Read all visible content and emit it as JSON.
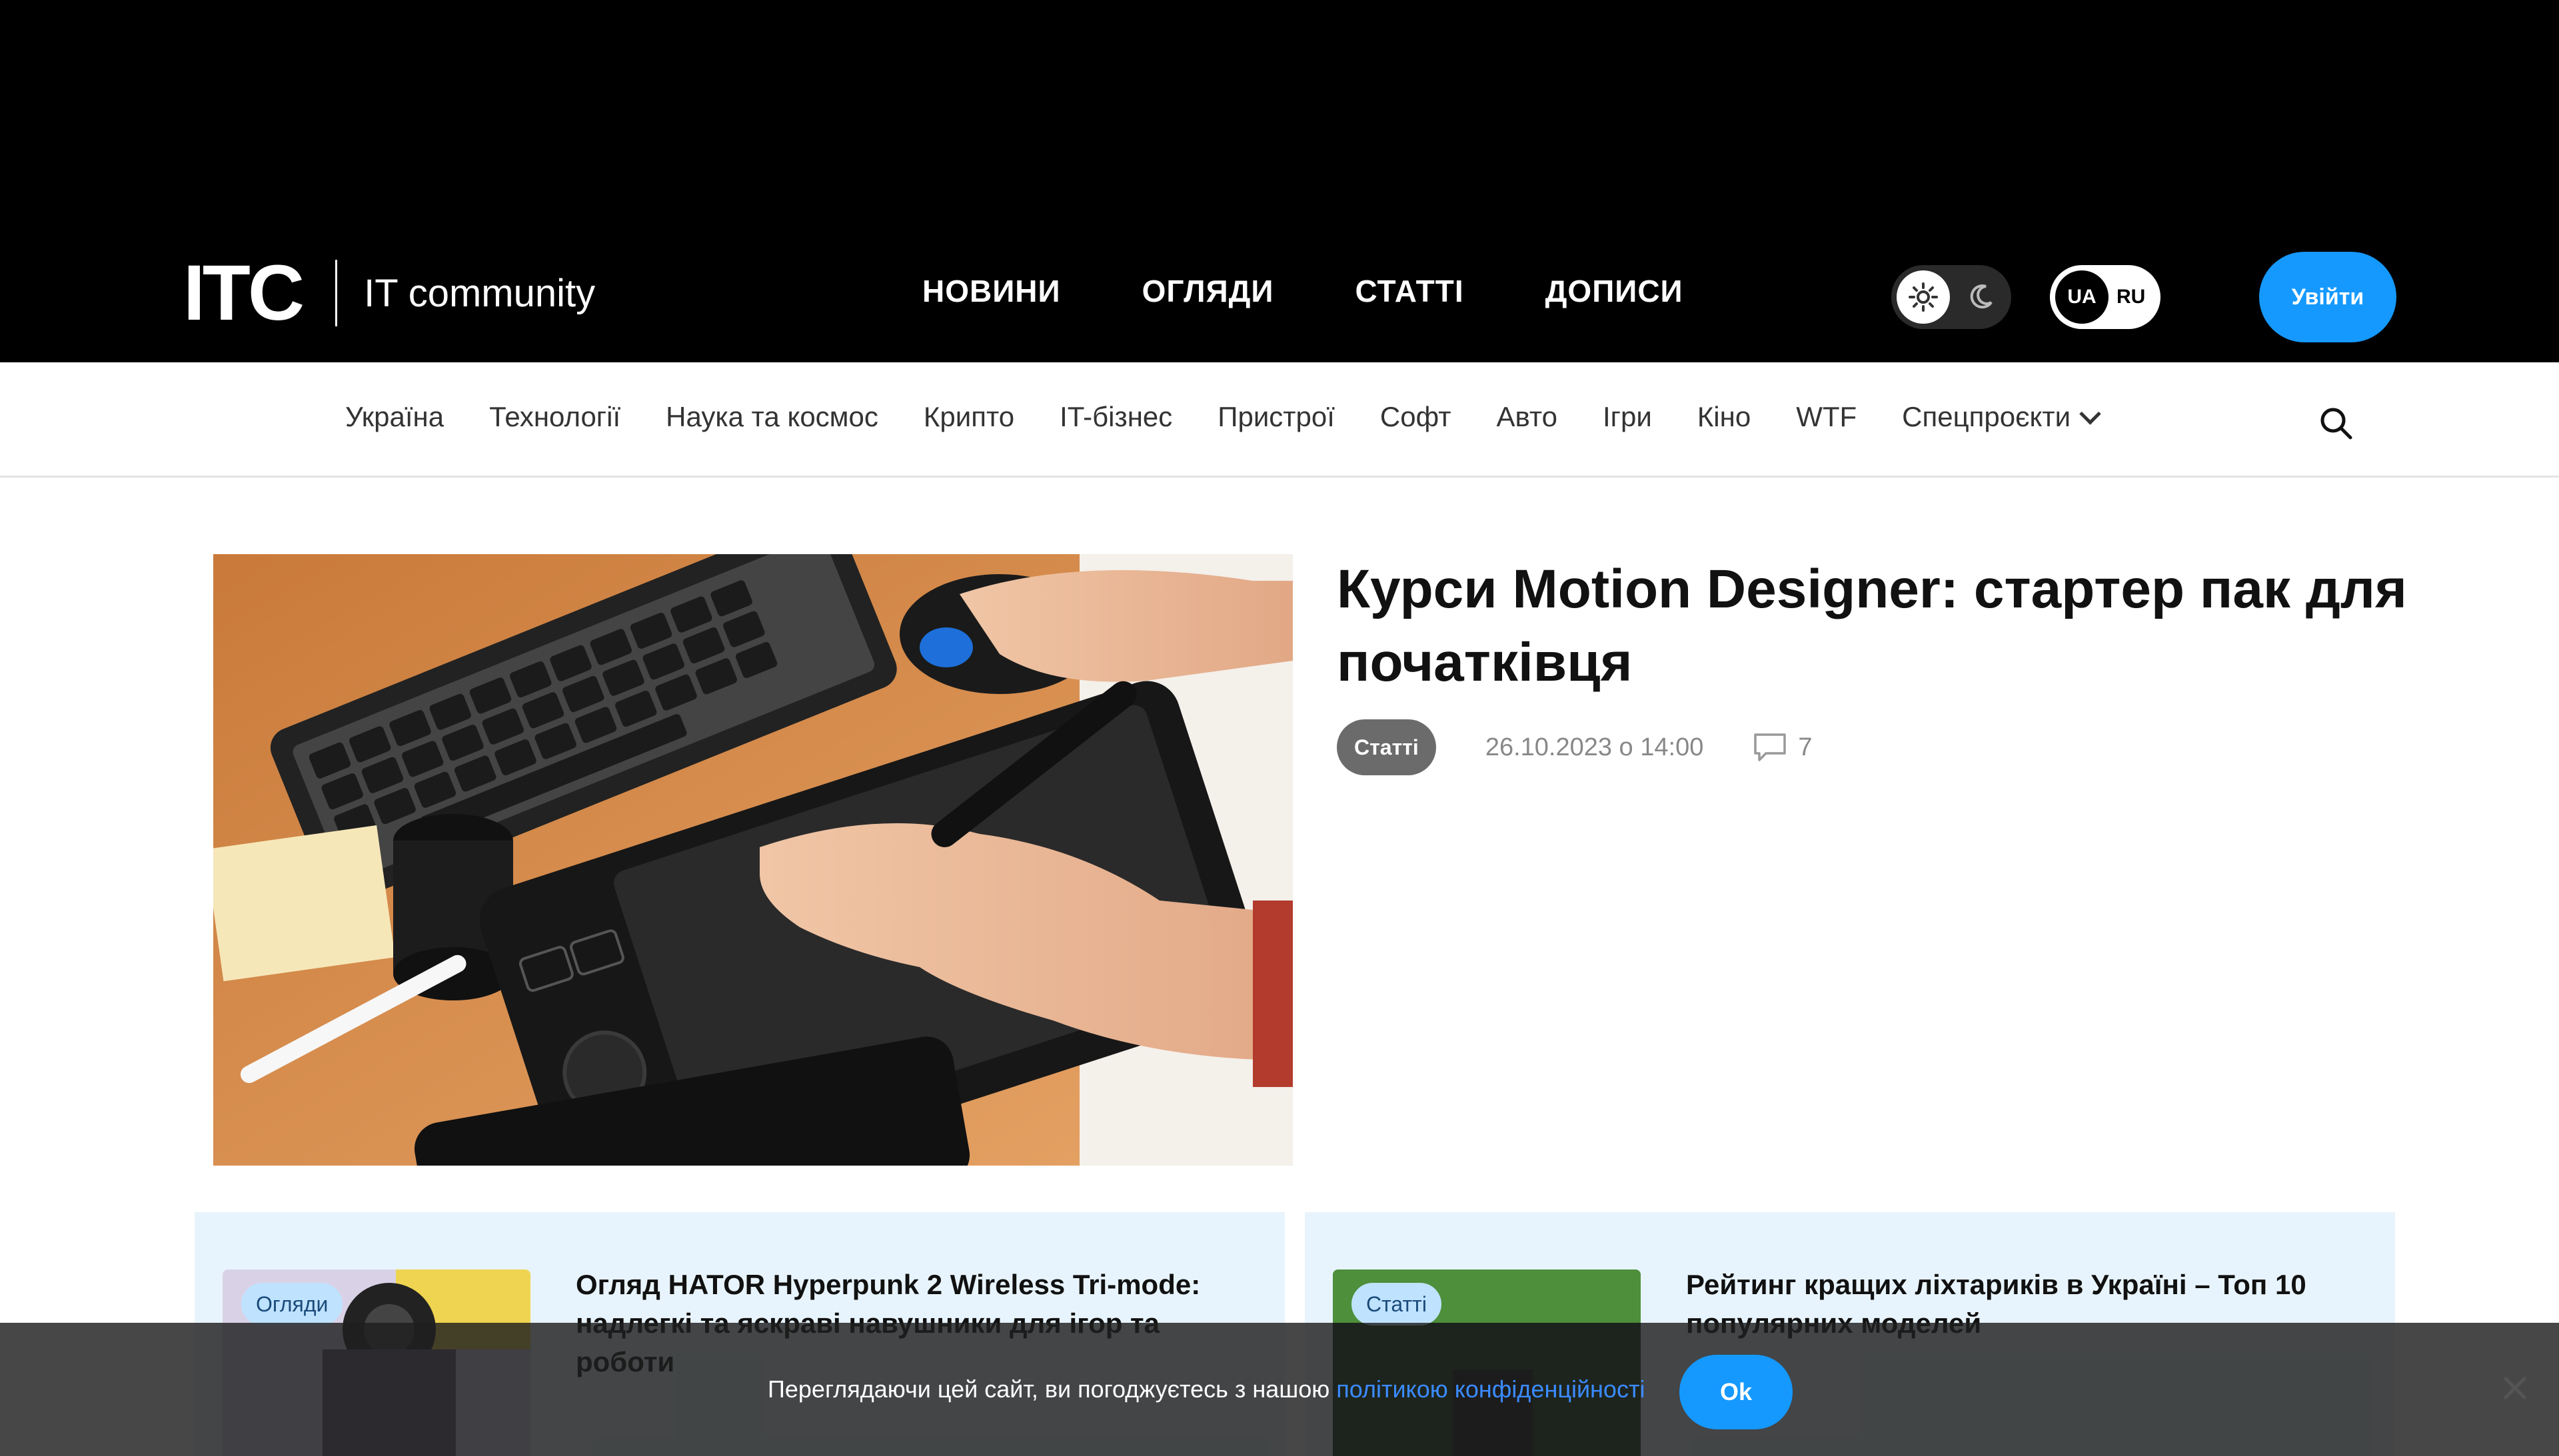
{
  "header": {
    "logo_mark": "ITC",
    "logo_text": "IT community",
    "nav": [
      "НОВИНИ",
      "ОГЛЯДИ",
      "СТАТТІ",
      "ДОПИСИ"
    ],
    "lang_active": "UA",
    "lang_other": "RU",
    "login_label": "Увійти"
  },
  "categories": [
    "Україна",
    "Технології",
    "Наука та космос",
    "Крипто",
    "IT-бізнес",
    "Пристрої",
    "Софт",
    "Авто",
    "Ігри",
    "Кіно",
    "WTF"
  ],
  "categories_dropdown": "Спецпроєкти",
  "hero": {
    "title": "Курси Motion Designer: стартер пак для початківця",
    "tag": "Статті",
    "date": "26.10.2023 о 14:00",
    "comments": "7"
  },
  "cards": [
    {
      "tag": "Огляди",
      "title": "Огляд HATOR Hyperpunk 2 Wireless Tri-mode: надлегкі та яскраві навушники для ігор та роботи"
    },
    {
      "tag": "Статті",
      "title": "Рейтинг кращих ліхтариків в Україні – Топ 10 популярних моделей"
    }
  ],
  "cookie": {
    "text": "Переглядаючи цей сайт, ви погоджуєтесь з нашою ",
    "link": "політикою конфіденційності",
    "ok_label": "Ok"
  },
  "colors": {
    "accent": "#1599ff",
    "header_bg": "#000000",
    "card_bg": "#e8f4fd"
  },
  "icons": [
    "sun-icon",
    "moon-icon",
    "search-icon",
    "chevron-down-icon",
    "comment-icon",
    "close-icon"
  ]
}
